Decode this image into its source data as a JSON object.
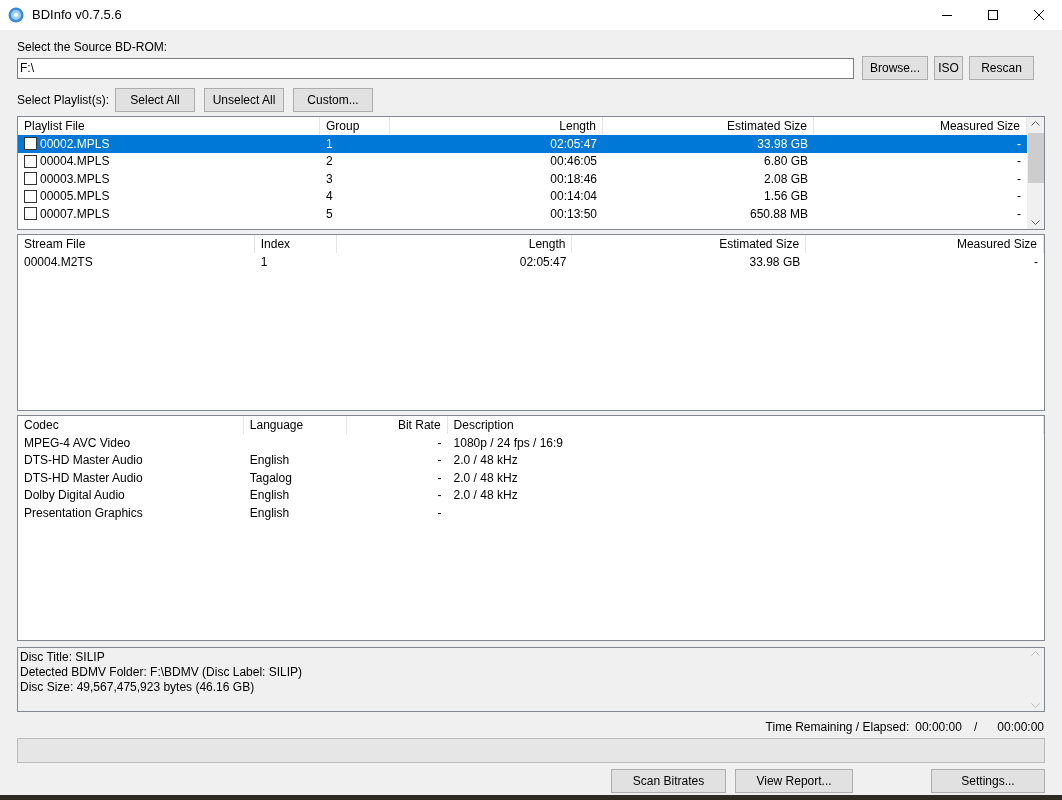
{
  "window": {
    "title": "BDInfo v0.7.5.6"
  },
  "source": {
    "label": "Select the Source BD-ROM:",
    "value": "F:\\",
    "buttons": [
      "Browse...",
      "ISO",
      "Rescan"
    ]
  },
  "playlist_controls": {
    "label": "Select Playlist(s):",
    "buttons": [
      "Select All",
      "Unselect All",
      "Custom..."
    ]
  },
  "playlists": {
    "columns": [
      "Playlist File",
      "Group",
      "Length",
      "Estimated Size",
      "Measured Size"
    ],
    "rows": [
      {
        "cells": [
          "00002.MPLS",
          "1",
          "02:05:47",
          "33.98 GB",
          "-"
        ],
        "checked": false,
        "selected": true
      },
      {
        "cells": [
          "00004.MPLS",
          "2",
          "00:46:05",
          "6.80 GB",
          "-"
        ],
        "checked": false,
        "selected": false
      },
      {
        "cells": [
          "00003.MPLS",
          "3",
          "00:18:46",
          "2.08 GB",
          "-"
        ],
        "checked": false,
        "selected": false
      },
      {
        "cells": [
          "00005.MPLS",
          "4",
          "00:14:04",
          "1.56 GB",
          "-"
        ],
        "checked": false,
        "selected": false
      },
      {
        "cells": [
          "00007.MPLS",
          "5",
          "00:13:50",
          "650.88 MB",
          "-"
        ],
        "checked": false,
        "selected": false
      }
    ]
  },
  "streams": {
    "columns": [
      "Stream File",
      "Index",
      "Length",
      "Estimated Size",
      "Measured Size"
    ],
    "rows": [
      {
        "cells": [
          "00004.M2TS",
          "1",
          "02:05:47",
          "33.98 GB",
          "-"
        ]
      }
    ]
  },
  "codecs": {
    "columns": [
      "Codec",
      "Language",
      "Bit Rate",
      "Description"
    ],
    "rows": [
      {
        "cells": [
          "MPEG-4 AVC Video",
          "",
          "-",
          "1080p / 24 fps / 16:9"
        ]
      },
      {
        "cells": [
          "DTS-HD Master Audio",
          "English",
          "-",
          "2.0 / 48 kHz"
        ]
      },
      {
        "cells": [
          "DTS-HD Master Audio",
          "Tagalog",
          "-",
          "2.0 / 48 kHz"
        ]
      },
      {
        "cells": [
          "Dolby Digital Audio",
          "English",
          "-",
          "2.0 / 48 kHz"
        ]
      },
      {
        "cells": [
          "Presentation Graphics",
          "English",
          "-",
          ""
        ]
      }
    ]
  },
  "disc_info": [
    "Disc Title: SILIP",
    "Detected BDMV Folder: F:\\BDMV (Disc Label: SILIP)",
    "Disc Size: 49,567,475,923 bytes (46.16 GB)"
  ],
  "time": {
    "label": "Time Remaining / Elapsed:",
    "remaining": "00:00:00",
    "separator": "/",
    "elapsed": "00:00:00"
  },
  "progress": {
    "level": 0
  },
  "bottom_buttons": [
    "Scan Bitrates",
    "View Report...",
    "Settings..."
  ]
}
